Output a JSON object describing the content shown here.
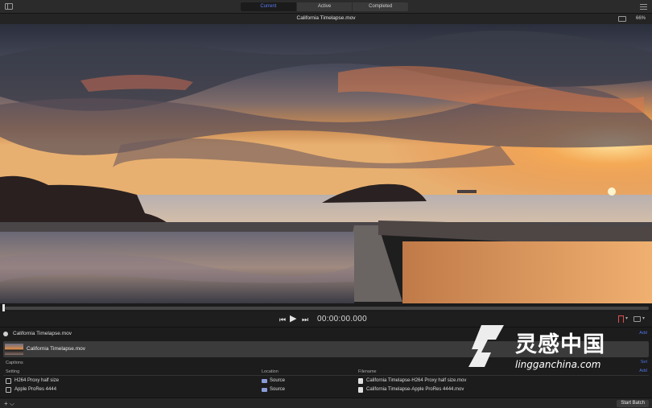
{
  "toolbar": {
    "tabs": [
      {
        "label": "Current",
        "active": true
      },
      {
        "label": "Active",
        "active": false
      },
      {
        "label": "Completed",
        "active": false
      }
    ]
  },
  "viewer": {
    "file_title": "California Timelapse.mov",
    "zoom": "66%"
  },
  "transport": {
    "timecode": "00:00:00.000"
  },
  "batch": {
    "title": "California Timelapse.mov",
    "add_label": "Add",
    "job": {
      "name": "California Timelapse.mov"
    },
    "captions_label": "Captions",
    "captions_action": "Set",
    "columns": {
      "setting": "Setting",
      "location": "Location",
      "filename": "Filename"
    },
    "table_add": "Add",
    "rows": [
      {
        "setting": "H264 Proxy half size",
        "location": "Source",
        "filename": "California Timelapse-H264 Proxy half size.mov"
      },
      {
        "setting": "Apple ProRes 4444",
        "location": "Source",
        "filename": "California Timelapse-Apple ProRes 4444.mov"
      }
    ]
  },
  "bottombar": {
    "add_menu": "+ ⌵",
    "start_batch": "Start Batch"
  },
  "watermark": {
    "cn": "灵感中国",
    "en": "lingganchina.com"
  },
  "colors": {
    "accent": "#4b74e8",
    "active_tab_text": "#5b7bf0",
    "marker": "#e05050"
  },
  "icons": {
    "sidebar": "sidebar-icon",
    "inspector": "inspector-icon",
    "view": "view-options-icon",
    "prev": "previous-frame-icon",
    "play": "play-icon",
    "next": "next-frame-icon",
    "marker": "marker-icon",
    "captions": "captions-icon",
    "folder": "folder-icon",
    "file": "file-icon"
  }
}
